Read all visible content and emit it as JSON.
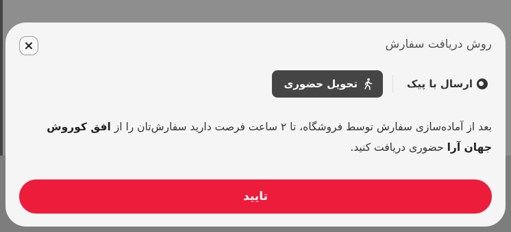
{
  "sheet": {
    "title": "روش دریافت سفارش",
    "close_icon": "close-icon"
  },
  "delivery_options": [
    {
      "label": "ارسال با پیک",
      "icon": "courier-icon",
      "selected": false
    },
    {
      "label": "تحویل حضوری",
      "icon": "walking-person-icon",
      "selected": true
    }
  ],
  "info": {
    "text_before": "بعد از آماده‌سازی سفارش توسط فروشگاه، تا ۲ ساعت فرصت دارید سفارش‌تان را از ",
    "store_name": "افق کوروش جهان آرا",
    "text_after": " حضوری دریافت کنید."
  },
  "confirm_label": "تایید",
  "colors": {
    "primary": "#ee1c3b",
    "selected_option_bg": "#454545",
    "sheet_bg": "#f5f5f5"
  }
}
